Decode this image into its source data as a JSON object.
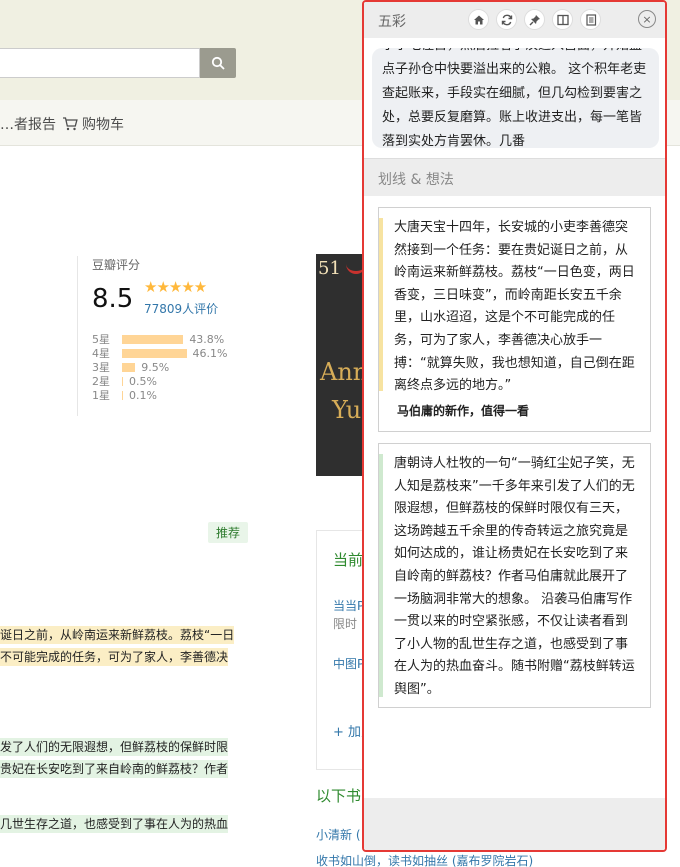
{
  "page": {
    "nav": {
      "report": "…者报告",
      "cart": "购物车"
    },
    "rating": {
      "title": "豆瓣评分",
      "score": "8.5",
      "stars": "★★★★★",
      "count": "77809人评价",
      "rows": [
        {
          "label": "5星",
          "pct": "43.8%",
          "value": 43.8
        },
        {
          "label": "4星",
          "pct": "46.1%",
          "value": 46.1
        },
        {
          "label": "3星",
          "pct": "9.5%",
          "value": 9.5
        },
        {
          "label": "2星",
          "pct": "0.5%",
          "value": 0.5
        },
        {
          "label": "1星",
          "pct": "0.1%",
          "value": 0.1
        }
      ]
    },
    "cover": {
      "t1": "51",
      "t2": "Ann",
      "t3": "Yu"
    },
    "recommend_tag": "推荐",
    "highlights": [
      "诞日之前，从岭南运来新鲜荔枝。荔枝“一日",
      "不可能完成的任务，可为了家人，李善德决",
      "发了人们的无限遐想，但鲜荔枝的保鲜时限",
      "贵妃在长安吃到了来自岭南的鲜荔枝？作者",
      "几世生存之道，也感受到了事在人为的热血"
    ],
    "side": {
      "title": "当前",
      "link1": "当当P",
      "gray1": "限时",
      "link2": "中图P",
      "add": "+ 加入"
    },
    "also": {
      "title": "以下书",
      "link1": "小清新 (",
      "link2": "收书如山倒，读书如抽丝 (嘉布罗院岩石)"
    }
  },
  "popup": {
    "title": "五彩",
    "icons": [
      "home-icon",
      "refresh-icon",
      "pin-icon",
      "sidebar-icon",
      "list-icon",
      "close-icon"
    ],
    "close_glyph": "×",
    "excerpt": "小小吃住古，然后拉着手汉追入宫面，开始盘点子孙仓中快要溢出来的公粮。 这个积年老吏查起账来，手段实在细腻，但几勾检到要害之处，总要反复磨算。账上收进支出，每一笔皆落到实处方肯罢休。几番",
    "section_title": "划线 & 想法",
    "notes": [
      {
        "text": "大唐天宝十四年，长安城的小吏李善德突然接到一个任务：要在贵妃诞日之前，从岭南运来新鲜荔枝。荔枝“一日色变，两日香变，三日味变”，而岭南距长安五千余里，山水迢迢，这是个不可能完成的任务，可为了家人，李善德决心放手一搏：“就算失败，我也想知道，自己倒在距离终点多远的地方。”",
        "comment": "马伯庸的新作，值得一看",
        "color": "#f7e3a1"
      },
      {
        "text": "唐朝诗人杜牧的一句“一骑红尘妃子笑，无人知是荔枝来”一千多年来引发了人们的无限遐想，但鲜荔枝的保鲜时限仅有三天，这场跨越五千余里的传奇转运之旅究竟是如何达成的，谁让杨贵妃在长安吃到了来自岭南的鲜荔枝？作者马伯庸就此展开了一场脑洞非常大的想象。 沿袭马伯庸写作一贯以来的时空紧张感，不仅让读者看到了小人物的乱世生存之道，也感受到了事在人为的热血奋斗。随书附赠“荔枝鲜转运舆图”。",
        "comment": "",
        "color": "#cfe9cf"
      }
    ],
    "colors": {
      "frame": "#e53935",
      "header_bg": "#ededed"
    }
  }
}
